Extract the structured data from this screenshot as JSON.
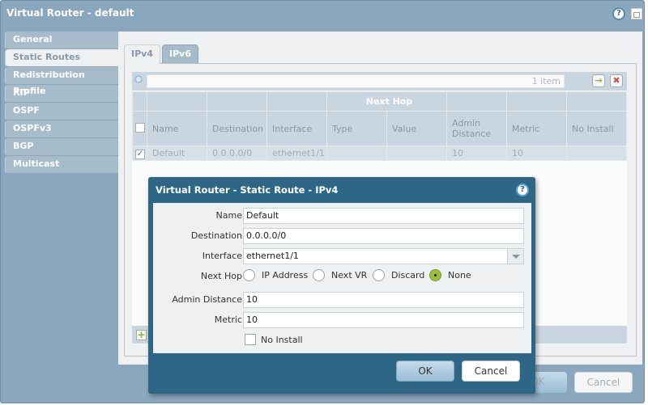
{
  "window": {
    "title": "Virtual Router - default"
  },
  "nav": {
    "items": [
      {
        "label": "General"
      },
      {
        "label": "Static Routes",
        "active": true
      },
      {
        "label": "Redistribution Profile"
      },
      {
        "label": "RIP"
      },
      {
        "label": "OSPF"
      },
      {
        "label": "OSPFv3"
      },
      {
        "label": "BGP"
      },
      {
        "label": "Multicast"
      }
    ]
  },
  "tabs": [
    {
      "label": "IPv4",
      "active": true
    },
    {
      "label": "IPv6"
    }
  ],
  "grid": {
    "count": "1 item",
    "group_header": "Next Hop",
    "columns": [
      "Name",
      "Destination",
      "Interface",
      "Type",
      "Value",
      "Admin Distance",
      "Metric",
      "No Install"
    ],
    "rows": [
      {
        "checked": true,
        "name": "Default",
        "destination": "0.0.0.0/0",
        "interface": "ethernet1/1",
        "type": "",
        "value": "",
        "admin_distance": "10",
        "metric": "10",
        "no_install": ""
      }
    ]
  },
  "footer": {
    "ok": "OK",
    "cancel": "Cancel"
  },
  "dialog": {
    "title": "Virtual Router - Static Route - IPv4",
    "name_label": "Name",
    "name": "Default",
    "destination_label": "Destination",
    "destination": "0.0.0.0/0",
    "interface_label": "Interface",
    "interface": "ethernet1/1",
    "next_hop_label": "Next Hop",
    "next_hop_options": [
      "IP Address",
      "Next VR",
      "Discard",
      "None"
    ],
    "next_hop_selected": "None",
    "admin_distance_label": "Admin Distance",
    "admin_distance": "10",
    "metric_label": "Metric",
    "metric": "10",
    "no_install_label": "No Install",
    "no_install": false,
    "ok": "OK",
    "cancel": "Cancel"
  },
  "colors": {
    "window_bg": "#8ba7bd",
    "dialog_bg": "#2e6686",
    "radio_selected": "#9bbf3a"
  }
}
